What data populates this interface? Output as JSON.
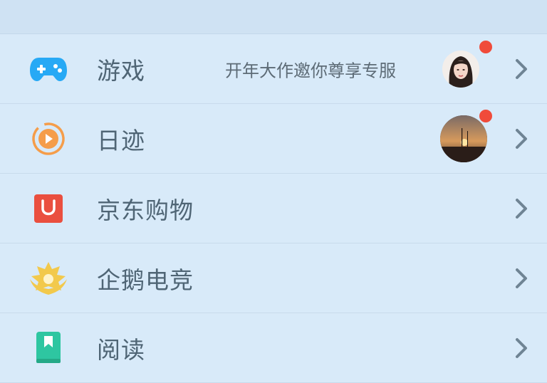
{
  "menu": {
    "items": [
      {
        "label": "游戏",
        "promo": "开年大作邀你尊享专服",
        "icon": "gamepad-icon",
        "has_avatar": true,
        "has_badge": true
      },
      {
        "label": "日迹",
        "icon": "play-circle-icon",
        "has_avatar": true,
        "has_badge": true
      },
      {
        "label": "京东购物",
        "icon": "shopping-bag-icon"
      },
      {
        "label": "企鹅电竞",
        "icon": "esports-crown-icon"
      },
      {
        "label": "阅读",
        "icon": "book-icon"
      }
    ]
  },
  "colors": {
    "background": "#d8eaf9",
    "badge": "#f04b3a",
    "game_icon": "#27a9f5",
    "riji_icon": "#f59d4a",
    "jd_icon": "#ea4f3f",
    "esports_icon": "#f2c94c",
    "read_icon": "#2ec6a1"
  }
}
